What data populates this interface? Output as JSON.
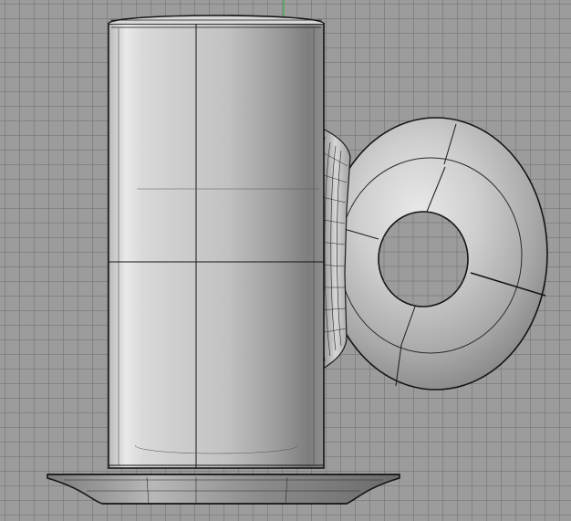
{
  "viewport": {
    "kind": "3d-modeling-viewport",
    "projection": "front-view",
    "render_mode": "shaded-with-isocurves",
    "grid": true
  },
  "colors": {
    "background": "#9c9c9c",
    "grid_minor": "#8a8a8a",
    "axis_y": "#3cb04a",
    "edge": "#141414",
    "surface_light": "#f2f2f2",
    "surface_mid": "#c8c8c8",
    "surface_dark": "#6e6e6e"
  },
  "scene": {
    "objects": [
      "mug-body",
      "mug-handle-torus",
      "handle-fillet",
      "saucer"
    ]
  }
}
